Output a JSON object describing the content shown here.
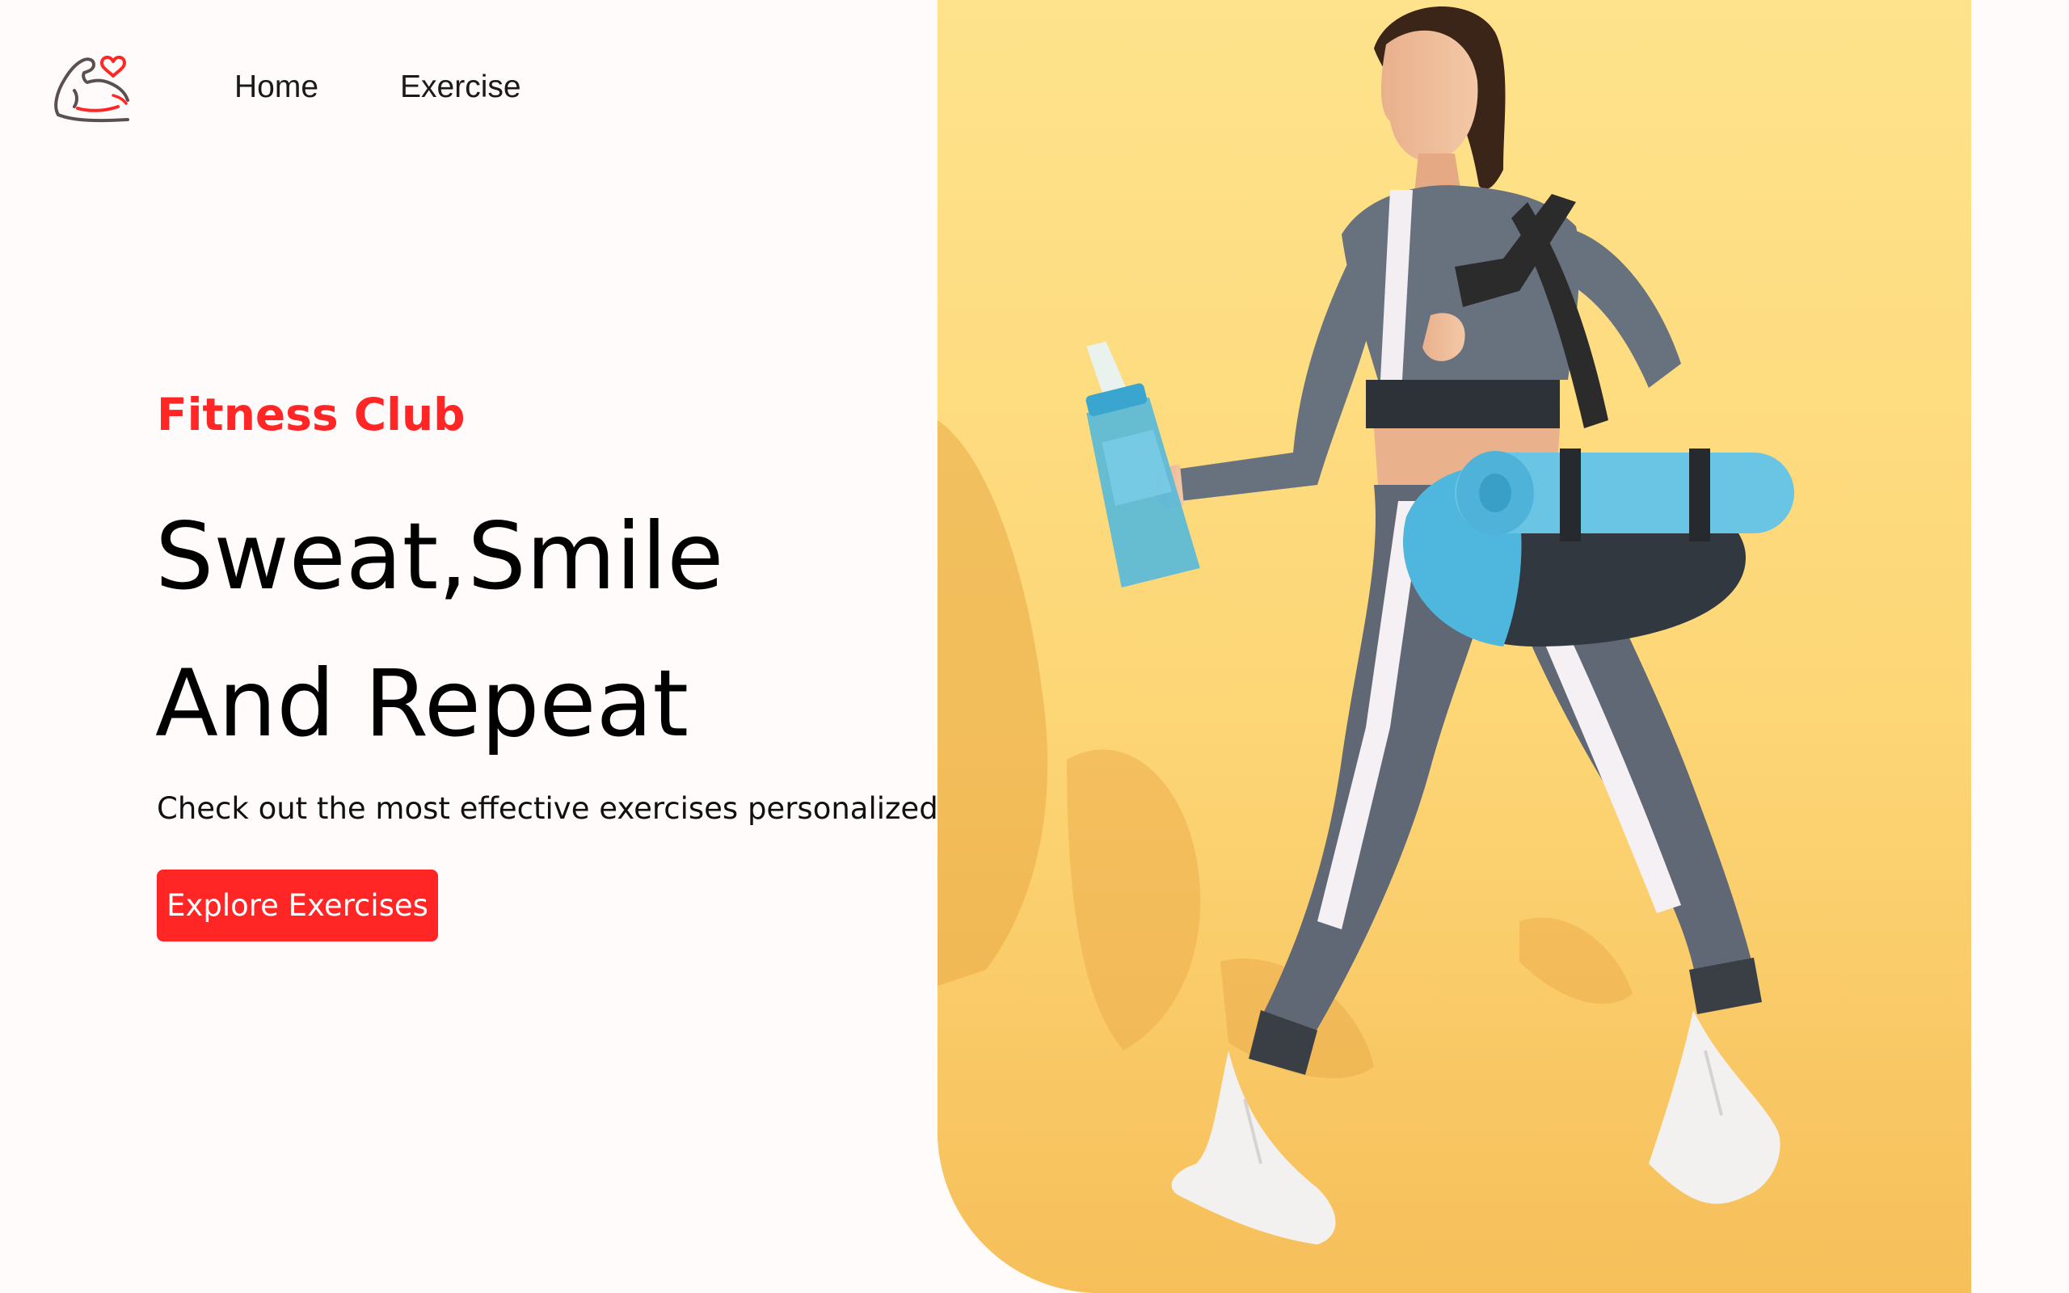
{
  "navbar": {
    "logo_icon": "flexed-arm-heart-icon",
    "links": [
      {
        "label": "Home"
      },
      {
        "label": "Exercise"
      }
    ]
  },
  "hero": {
    "subtitle": "Fitness Club",
    "title_line1": "Sweat,Smile",
    "title_line2": "And Repeat",
    "description": "Check out the most effective exercises personalized to you",
    "cta_label": "Explore Exercises",
    "banner_image": "woman-walking-with-gym-bag-photo"
  },
  "colors": {
    "accent": "#ff2625",
    "background": "#fffbfb",
    "banner_background": "#fddc7e"
  }
}
